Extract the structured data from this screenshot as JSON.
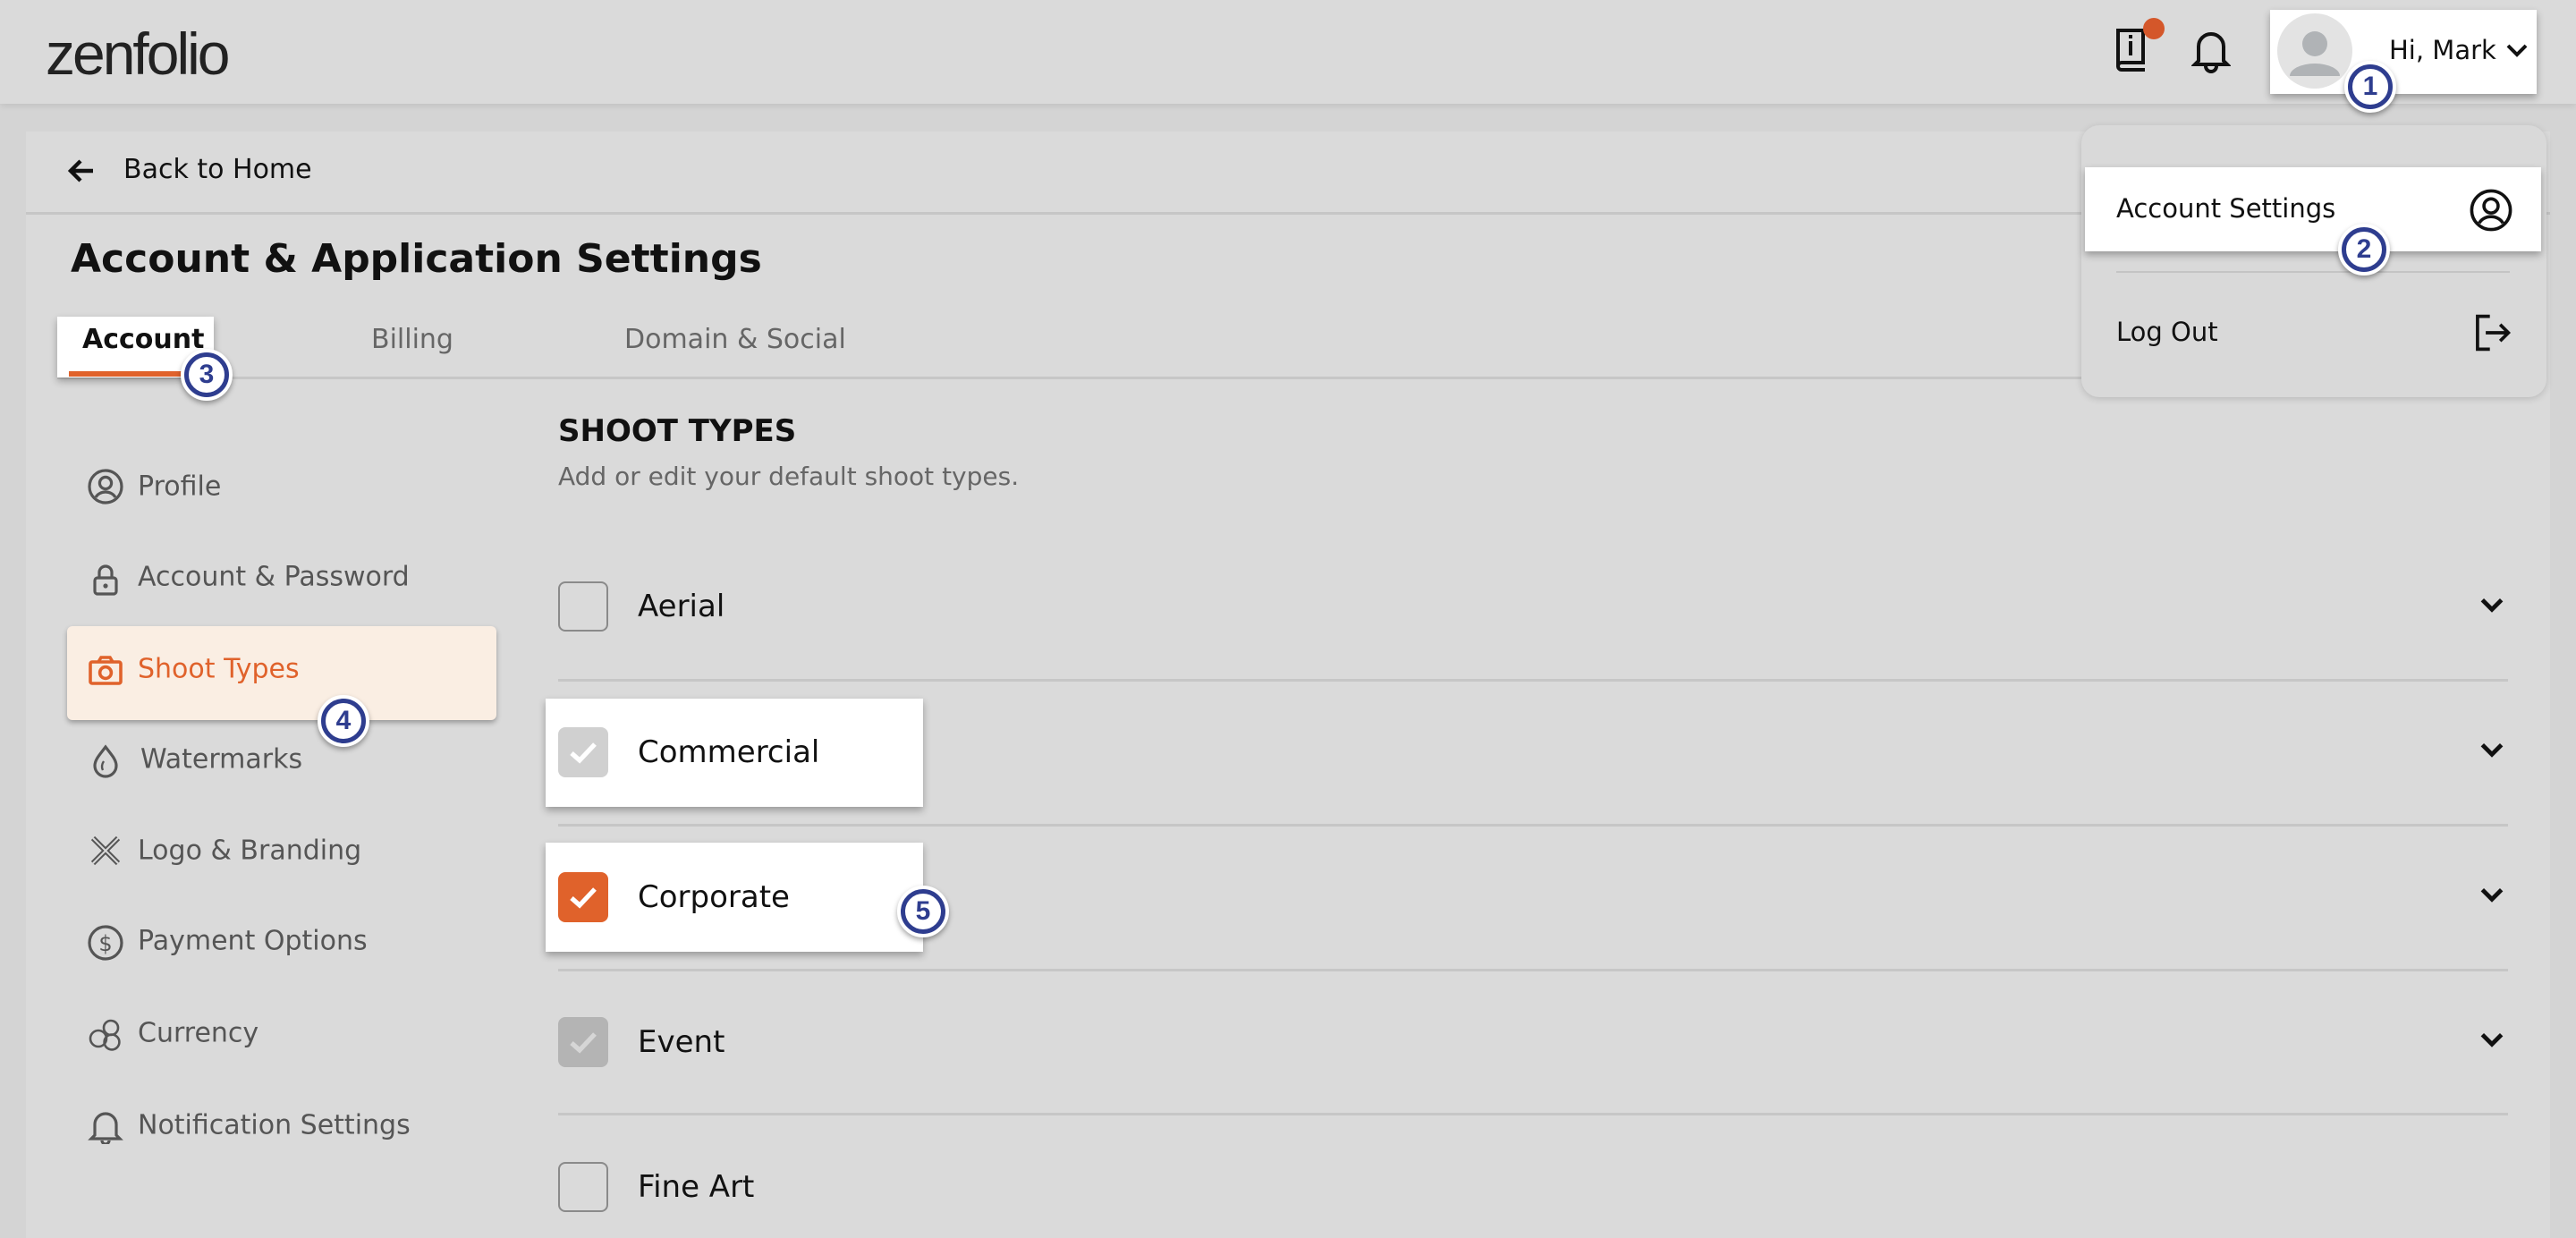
{
  "header": {
    "logo": "zenfolio",
    "greeting": "Hi, Mark",
    "icons": [
      "info-book-icon",
      "bell-icon",
      "avatar",
      "chevron-down-icon"
    ],
    "notification_dot_color": "#d4572a"
  },
  "user_menu": {
    "items": [
      {
        "label": "Account Settings",
        "icon": "user-circle-icon"
      },
      {
        "label": "Log Out",
        "icon": "logout-icon"
      }
    ]
  },
  "nav": {
    "back_label": "Back to Home"
  },
  "page": {
    "title": "Account & Application Settings"
  },
  "tabs": [
    {
      "label": "Account",
      "active": true
    },
    {
      "label": "Billing",
      "active": false
    },
    {
      "label": "Domain & Social",
      "active": false
    }
  ],
  "sidebar": {
    "items": [
      {
        "label": "Profile",
        "icon": "user-circle-icon"
      },
      {
        "label": "Account & Password",
        "icon": "lock-icon"
      },
      {
        "label": "Shoot Types",
        "icon": "camera-icon",
        "active": true
      },
      {
        "label": "Watermarks",
        "icon": "drop-icon"
      },
      {
        "label": "Logo & Branding",
        "icon": "pencil-ruler-icon"
      },
      {
        "label": "Payment Options",
        "icon": "dollar-circle-icon"
      },
      {
        "label": "Currency",
        "icon": "coins-icon"
      },
      {
        "label": "Notification Settings",
        "icon": "bell-icon"
      }
    ]
  },
  "section": {
    "title": "SHOOT TYPES",
    "subtitle": "Add or edit your default shoot types."
  },
  "shoot_types": [
    {
      "label": "Aerial",
      "state": "unchecked"
    },
    {
      "label": "Commercial",
      "state": "checked-disabled"
    },
    {
      "label": "Corporate",
      "state": "checked"
    },
    {
      "label": "Event",
      "state": "checked-disabled"
    },
    {
      "label": "Fine Art",
      "state": "unchecked"
    }
  ],
  "annotations": [
    "1",
    "2",
    "3",
    "4",
    "5"
  ],
  "colors": {
    "accent": "#e0622b",
    "active_bg": "#faeee3",
    "annotation": "#2e3d8f"
  }
}
